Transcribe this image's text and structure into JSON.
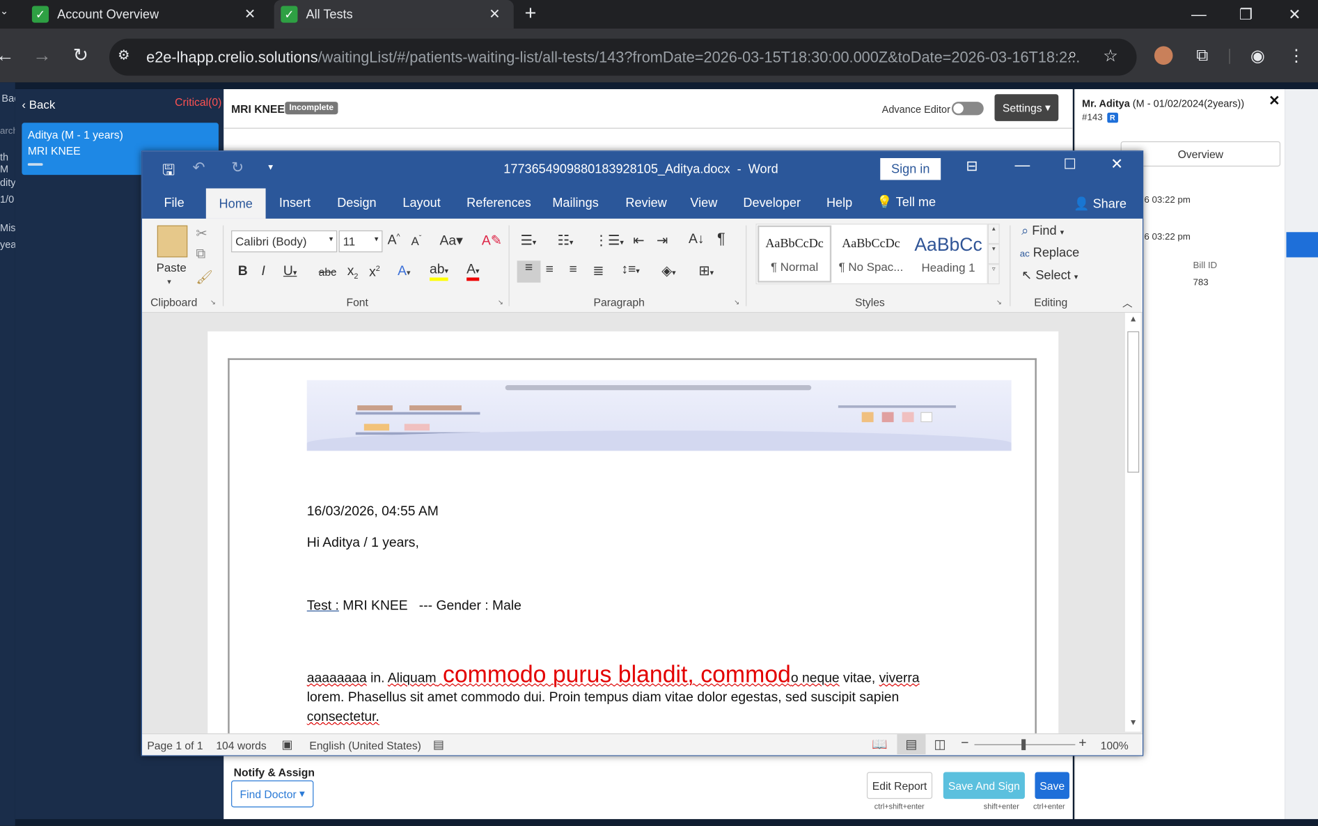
{
  "browser": {
    "tabs": [
      {
        "label": "Account Overview"
      },
      {
        "label": "All Tests"
      }
    ],
    "url_host": "e2e-lhapp.crelio.solutions",
    "url_path": "/waitingList/#/patients-waiting-list/all-tests/143?fromDate=2026-03-15T18:30:00.000Z&toDate=2026-03-16T18:2..."
  },
  "leftpanel": {
    "back": "Back",
    "critical": "Critical(0)",
    "patient_name": "Aditya (M - 1 years)",
    "patient_test": "MRI KNEE",
    "side_texts": [
      "Bac",
      "arch",
      "th M",
      "dity",
      "1/0",
      "Miss",
      "yea"
    ]
  },
  "report": {
    "title": "MRI KNEE",
    "status": "Incomplete",
    "advance_editor": "Advance Editor",
    "settings": "Settings",
    "notify": "Notify & Assign",
    "find_doctor": "Find Doctor",
    "edit_report": "Edit Report",
    "edit_report_hint": "ctrl+shift+enter",
    "save_sign": "Save And Sign",
    "save_sign_hint": "shift+enter",
    "save": "Save",
    "save_hint": "ctrl+enter"
  },
  "rightpanel": {
    "patient": "Mr. Aditya",
    "patient_meta": "(M - 01/02/2024(2years))",
    "id": "#143",
    "badge": "R",
    "overview": "Overview",
    "time1": "6 03:22 pm",
    "time2": "6 03:22 pm",
    "bill_label": "Bill ID",
    "bill_value": "783"
  },
  "word": {
    "title": "1773654909880183928105_Aditya.docx  -  Word",
    "sign_in": "Sign in",
    "tabs": [
      "File",
      "Home",
      "Insert",
      "Design",
      "Layout",
      "References",
      "Mailings",
      "Review",
      "View",
      "Developer",
      "Help",
      "Tell me"
    ],
    "share": "Share",
    "clipboard": {
      "paste": "Paste",
      "group": "Clipboard"
    },
    "font": {
      "name": "Calibri (Body)",
      "size": "11",
      "group": "Font"
    },
    "paragraph": {
      "group": "Paragraph"
    },
    "styles": {
      "items": [
        {
          "preview": "AaBbCcDc",
          "name": "¶ Normal"
        },
        {
          "preview": "AaBbCcDc",
          "name": "¶ No Spac..."
        },
        {
          "preview": "AaBbCc",
          "name": "Heading 1"
        }
      ],
      "group": "Styles"
    },
    "editing": {
      "find": "Find",
      "replace": "Replace",
      "select": "Select",
      "group": "Editing"
    },
    "document": {
      "date": "16/03/2026, 04:55 AM",
      "greeting": "Hi Aditya / 1 years,",
      "test_label": "Test :",
      "test_rest": " MRI KNEE   --- Gender : Male",
      "p1_a": "aaaaaaaa",
      "p1_b": " in. ",
      "p1_c": "Aliquam",
      "p1_red": " commodo purus blandit, commod",
      "p1_d": "o neque",
      "p1_e": " vitae, ",
      "p1_f": "viverra",
      "p2": "lorem. Phasellus sit amet commodo dui. Proin tempus diam vitae dolor egestas, sed suscipit sapien",
      "p3": "consectetur."
    },
    "status": {
      "page": "Page 1 of 1",
      "words": "104 words",
      "language": "English (United States)",
      "zoom": "100%"
    }
  }
}
